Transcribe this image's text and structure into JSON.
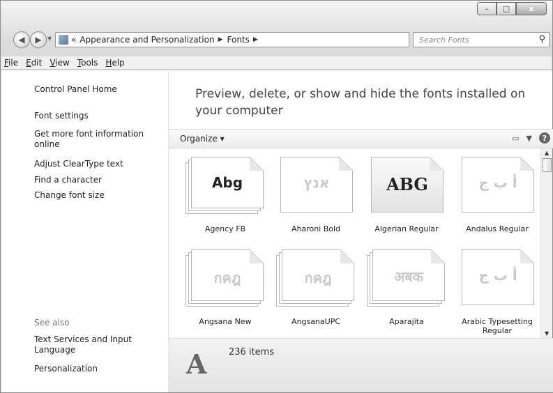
{
  "window": {
    "minimize": "–",
    "maximize": "□",
    "close": "x"
  },
  "address": {
    "overflow": "«",
    "segments": [
      "Appearance and Personalization",
      "Fonts"
    ],
    "refresh": "↻"
  },
  "search": {
    "placeholder": "Search Fonts"
  },
  "menu": [
    {
      "label": "File",
      "key": "F",
      "rest": "ile"
    },
    {
      "label": "Edit",
      "key": "E",
      "rest": "dit"
    },
    {
      "label": "View",
      "key": "V",
      "rest": "iew"
    },
    {
      "label": "Tools",
      "key": "T",
      "rest": "ools"
    },
    {
      "label": "Help",
      "key": "H",
      "rest": "elp"
    }
  ],
  "sidebar": {
    "items": [
      "Control Panel Home",
      "Font settings",
      "Get more font information online",
      "Adjust ClearType text",
      "Find a character",
      "Change font size"
    ],
    "see_also_title": "See also",
    "see_also": [
      "Text Services and Input Language",
      "Personalization"
    ]
  },
  "main": {
    "headline": "Preview, delete, or show and hide the fonts installed on your computer",
    "organize": "Organize ▾",
    "fonts": [
      {
        "name": "Agency FB",
        "sample": "Abg",
        "stack": true,
        "dim": false
      },
      {
        "name": "Aharoni Bold",
        "sample": "אנץ",
        "stack": false,
        "dim": true
      },
      {
        "name": "Algerian Regular",
        "sample": "ABG",
        "stack": false,
        "dim": false
      },
      {
        "name": "Andalus Regular",
        "sample": "أ ب ج",
        "stack": false,
        "dim": true
      },
      {
        "name": "Angsana New",
        "sample": "กคฎ",
        "stack": true,
        "dim": true
      },
      {
        "name": "AngsanaUPC",
        "sample": "กคฎ",
        "stack": true,
        "dim": true
      },
      {
        "name": "Aparajita",
        "sample": "अबक",
        "stack": true,
        "dim": true
      },
      {
        "name": "Arabic Typesetting Regular",
        "sample": "أ ب ج",
        "stack": false,
        "dim": true
      }
    ],
    "status_count": "236 items",
    "status_icon_letter": "A"
  }
}
